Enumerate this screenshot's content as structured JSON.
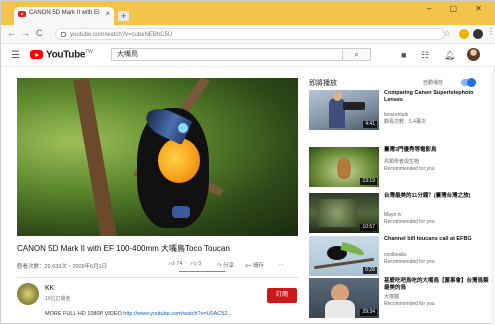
{
  "browser": {
    "tab_title": "CANON 5D Mark II with EI",
    "tab_close": "×",
    "new_tab": "+",
    "window_buttons": "– ▢ ✕",
    "url": "youtube.com/watch?v=cubeNEBhC5U",
    "nav_back": "←",
    "nav_forward": "→",
    "nav_reload": "C"
  },
  "youtube": {
    "brand": "YouTube",
    "brand_region": "TW",
    "search_value": "大嘴鳥",
    "search_icon": "search-icon"
  },
  "video": {
    "title": "CANON 5D Mark II with EF 100-400mm 大嘴鳥Toco Toucan",
    "meta": "觀看次數：29,633次・2009年6月1日",
    "likes": "74",
    "dislikes": "3",
    "share_label": "分享",
    "save_label": "儲存",
    "more_label": "...",
    "like_ratio": 0.96
  },
  "channel": {
    "name": "KK",
    "subscribers": "16位訂閱者",
    "subscribe_label": "訂閱",
    "description_prefix": "MORE FULL HD 1080P VIDEO",
    "description_link": "http://www.youtube.com/watch?v=U0AC52..."
  },
  "sidebar": {
    "up_next": "即將播放",
    "autoplay_label": "自動播放",
    "autoplay_on": true,
    "items": [
      {
        "title": "Comparing Canon Supertelephoto Lenses",
        "line1": "lensrentals",
        "line2": "觀看次數：5.4萬次",
        "duration": "4:41"
      },
      {
        "title": "臺灣3門優秀等電影鳥",
        "line1": "鳥類學者與生物",
        "line2": "Recommended for you",
        "duration": "13:19"
      },
      {
        "title": "台灣最美的11分鐘？(臺灣台灣之旅)",
        "line1": "Mayo tv",
        "line2": "Recommended for you",
        "duration": "10:57"
      },
      {
        "title": "Channel bill toucans call at EFBG",
        "line1": "coolbeaks",
        "line2": "Recommended for you",
        "duration": "0:28"
      },
      {
        "title": "甚麼吃吧鳥吃的大嘴鳥【董事會】台灣鳥類最美的鳥",
        "line1": "大咖貓",
        "line2": "Recommended for you",
        "duration": "29:34"
      }
    ]
  }
}
